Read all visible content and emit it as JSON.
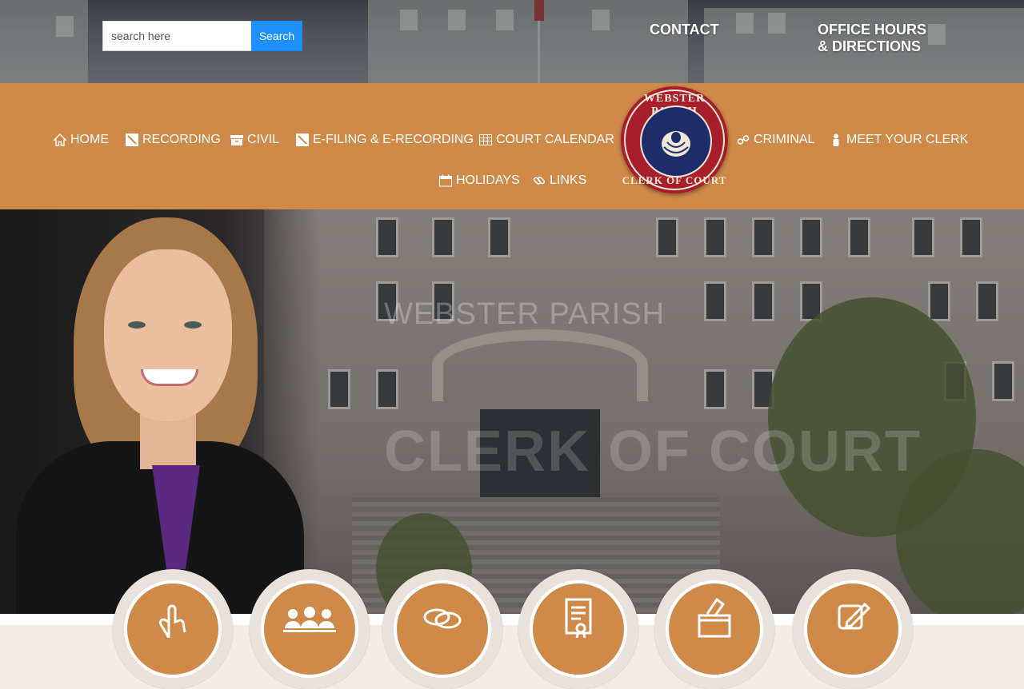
{
  "search": {
    "placeholder": "search here",
    "button_label": "Search"
  },
  "top_links": {
    "contact": "CONTACT",
    "hours": "OFFICE HOURS\n& DIRECTIONS"
  },
  "nav": {
    "items": [
      {
        "label": "HOME",
        "icon": "home-icon"
      },
      {
        "label": "RECORDING",
        "icon": "pen-icon"
      },
      {
        "label": "CIVIL",
        "icon": "archive-icon"
      },
      {
        "label": "E-FILING & E-RECORDING",
        "icon": "pen-icon"
      },
      {
        "label": "COURT CALENDAR",
        "icon": "calendar-grid-icon"
      },
      {
        "label": "CRIMINAL",
        "icon": "handcuffs-icon"
      },
      {
        "label": "MEET YOUR CLERK",
        "icon": "person-icon"
      },
      {
        "label": "HOLIDAYS",
        "icon": "calendar-icon"
      },
      {
        "label": "LINKS",
        "icon": "link-icon"
      }
    ],
    "seal": {
      "top_text": "WEBSTER PARISH",
      "bottom_text": "CLERK OF COURT"
    }
  },
  "hero": {
    "title_line1": "WEBSTER PARISH",
    "title_line2": "CLERK OF COURT"
  },
  "service_circles": [
    {
      "icon": "pointer-hand-icon"
    },
    {
      "icon": "group-icon"
    },
    {
      "icon": "rings-icon"
    },
    {
      "icon": "certificate-icon"
    },
    {
      "icon": "ballot-box-icon"
    },
    {
      "icon": "edit-form-icon"
    }
  ],
  "colors": {
    "nav_bg": "#cf8a4a",
    "search_button": "#1e90ff",
    "seal_red": "#a71f2a",
    "seal_blue": "#1f2c6a"
  }
}
